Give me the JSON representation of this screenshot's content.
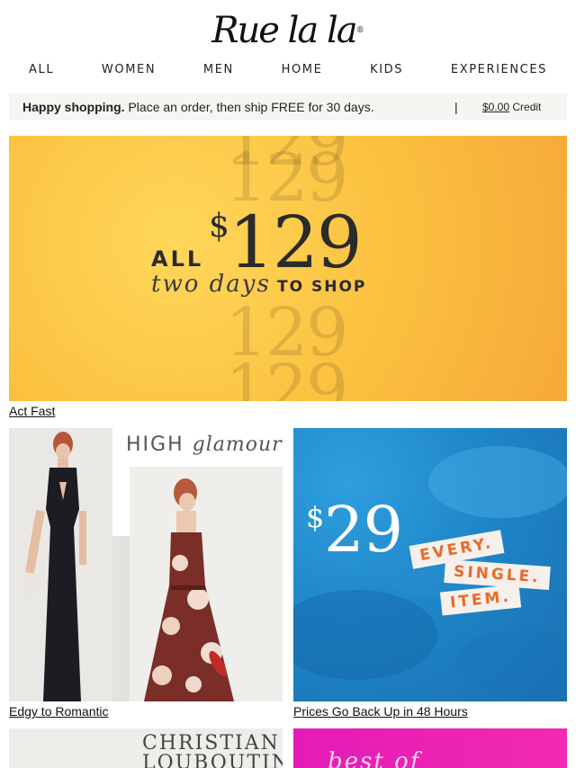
{
  "brand": {
    "logo_text": "Rue la la",
    "reg_mark": "®"
  },
  "nav": [
    "ALL",
    "WOMEN",
    "MEN",
    "HOME",
    "KIDS",
    "EXPERIENCES"
  ],
  "promo": {
    "bold": "Happy shopping.",
    "text": "Place an order, then ship FREE for 30 days.",
    "separator": "|",
    "credit_amount": "$0.00",
    "credit_label": "Credit"
  },
  "hero": {
    "all": "ALL",
    "dollar": "$",
    "price": "129",
    "days": "two days",
    "toshop": "TO SHOP",
    "ghost": [
      "129",
      "129",
      "129",
      "129"
    ],
    "caption": "Act Fast"
  },
  "tiles": [
    {
      "headline_plain": "HIGH",
      "headline_italic": "glamour",
      "caption": "Edgy to Romantic"
    },
    {
      "dollar": "$",
      "price": "29",
      "tags": [
        "EVERY.",
        "SINGLE.",
        "ITEM."
      ],
      "caption": "Prices Go Back Up in 48 Hours"
    }
  ],
  "bottom_tiles": [
    {
      "text_line1": "CHRISTIAN",
      "text_line2": "LOUBOUTIN"
    },
    {
      "text": "best of"
    }
  ],
  "colors": {
    "hero_yellow": "#fbbf3e",
    "blue_tile": "#1e86c9",
    "tag_orange": "#ea6b2a",
    "pink_tile": "#e21cb6"
  }
}
